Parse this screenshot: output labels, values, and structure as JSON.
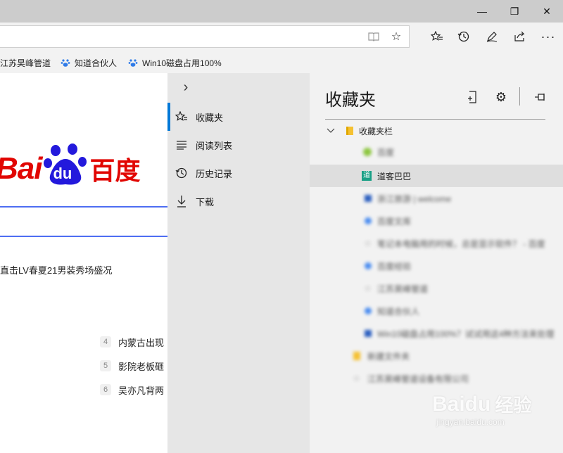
{
  "window": {
    "minimize_label": "—",
    "restore_label": "❐",
    "close_label": "✕"
  },
  "toolbar": {
    "icons": [
      "reading-view-icon",
      "star-icon",
      "favorites-icon",
      "history-icon",
      "pen-icon",
      "share-icon",
      "more-icon"
    ]
  },
  "favorites_bar": {
    "items": [
      {
        "label": "江苏昊峰管道"
      },
      {
        "label": "知道合伙人"
      },
      {
        "label": "Win10磁盘占用100%"
      }
    ]
  },
  "page": {
    "logo_text_left": "Bai",
    "logo_text_du": "du",
    "logo_text_right": "百度",
    "headline": "直击LV春夏21男装秀场盛况",
    "hot_list": [
      {
        "rank": "4",
        "text": "内蒙古出现"
      },
      {
        "rank": "5",
        "text": "影院老板砸"
      },
      {
        "rank": "6",
        "text": "吴亦凡背两"
      }
    ]
  },
  "hub_nav": {
    "collapse_icon": "›",
    "items": [
      {
        "label": "收藏夹",
        "icon": "favorites-icon",
        "active": true
      },
      {
        "label": "阅读列表",
        "icon": "reading-list-icon",
        "active": false
      },
      {
        "label": "历史记录",
        "icon": "history-icon",
        "active": false
      },
      {
        "label": "下载",
        "icon": "download-icon",
        "active": false
      }
    ]
  },
  "hub_panel": {
    "title": "收藏夹",
    "folder_label": "收藏夹栏",
    "items": [
      {
        "label": "百度",
        "blurred": true
      },
      {
        "label": "道客巴巴",
        "blurred": false,
        "highlighted": true
      },
      {
        "label": "浙江旅游 | welcome",
        "blurred": true
      },
      {
        "label": "百度文库",
        "blurred": true
      },
      {
        "label": "笔记本电脑用的时候，总是显示软件？ - 百度",
        "blurred": true
      },
      {
        "label": "百度经验",
        "blurred": true
      },
      {
        "label": "江苏昊峰管道",
        "blurred": true
      },
      {
        "label": "知道合伙人",
        "blurred": true
      },
      {
        "label": "Win10磁盘占用100%？试试用这4种方法来处理",
        "blurred": true
      }
    ],
    "folders": [
      {
        "label": "新建文件夹",
        "blurred": true
      },
      {
        "label": "江苏昊峰管道设备有限公司",
        "blurred": true
      }
    ]
  },
  "watermark": {
    "brand": "Baidu",
    "cn": "经验",
    "url": "jingyan.baidu.com"
  },
  "colors": {
    "titlebar": "#cccccc",
    "hub_nav_bg": "#e6e6e6",
    "hub_panel_bg": "#f2f2f2",
    "accent": "#0078d7",
    "baidu_red": "#e10602",
    "baidu_blue": "#2319dc"
  }
}
